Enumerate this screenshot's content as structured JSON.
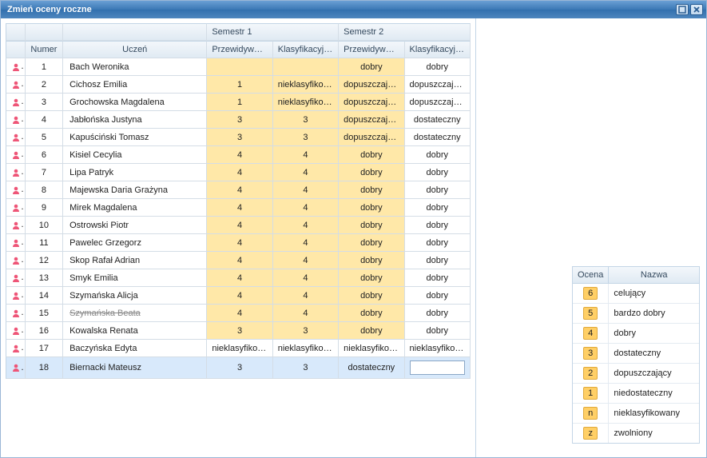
{
  "window": {
    "title": "Zmień oceny roczne"
  },
  "headers": {
    "number": "Numer",
    "student": "Uczeń",
    "sem1": "Semestr 1",
    "sem2": "Semestr 2",
    "predicted": "Przewidywana",
    "classification": "Klasyfikacyjna"
  },
  "legend": {
    "code_header": "Ocena",
    "name_header": "Nazwa",
    "items": [
      {
        "code": "6",
        "name": "celujący"
      },
      {
        "code": "5",
        "name": "bardzo dobry"
      },
      {
        "code": "4",
        "name": "dobry"
      },
      {
        "code": "3",
        "name": "dostateczny"
      },
      {
        "code": "2",
        "name": "dopuszczający"
      },
      {
        "code": "1",
        "name": "niedostateczny"
      },
      {
        "code": "n",
        "name": "nieklasyfikowany"
      },
      {
        "code": "z",
        "name": "zwolniony"
      }
    ]
  },
  "rows": [
    {
      "num": "1",
      "name": "Bach Weronika",
      "s1p": "",
      "s1k": "",
      "s2p": "dobry",
      "s2k": "dobry"
    },
    {
      "num": "2",
      "name": "Cichosz Emilia",
      "s1p": "1",
      "s1k": "nieklasyfikow...",
      "s2p": "dopuszczający",
      "s2k": "dopuszczający"
    },
    {
      "num": "3",
      "name": "Grochowska Magdalena",
      "s1p": "1",
      "s1k": "nieklasyfikow...",
      "s2p": "dopuszczający",
      "s2k": "dopuszczający"
    },
    {
      "num": "4",
      "name": "Jabłońska Justyna",
      "s1p": "3",
      "s1k": "3",
      "s2p": "dopuszczający",
      "s2k": "dostateczny"
    },
    {
      "num": "5",
      "name": "Kapuściński Tomasz",
      "s1p": "3",
      "s1k": "3",
      "s2p": "dopuszczający",
      "s2k": "dostateczny"
    },
    {
      "num": "6",
      "name": "Kisiel Cecylia",
      "s1p": "4",
      "s1k": "4",
      "s2p": "dobry",
      "s2k": "dobry"
    },
    {
      "num": "7",
      "name": "Lipa Patryk",
      "s1p": "4",
      "s1k": "4",
      "s2p": "dobry",
      "s2k": "dobry"
    },
    {
      "num": "8",
      "name": "Majewska Daria Grażyna",
      "s1p": "4",
      "s1k": "4",
      "s2p": "dobry",
      "s2k": "dobry"
    },
    {
      "num": "9",
      "name": "Mirek Magdalena",
      "s1p": "4",
      "s1k": "4",
      "s2p": "dobry",
      "s2k": "dobry"
    },
    {
      "num": "10",
      "name": "Ostrowski Piotr",
      "s1p": "4",
      "s1k": "4",
      "s2p": "dobry",
      "s2k": "dobry"
    },
    {
      "num": "11",
      "name": "Pawelec Grzegorz",
      "s1p": "4",
      "s1k": "4",
      "s2p": "dobry",
      "s2k": "dobry"
    },
    {
      "num": "12",
      "name": "Skop Rafał Adrian",
      "s1p": "4",
      "s1k": "4",
      "s2p": "dobry",
      "s2k": "dobry"
    },
    {
      "num": "13",
      "name": "Smyk Emilia",
      "s1p": "4",
      "s1k": "4",
      "s2p": "dobry",
      "s2k": "dobry"
    },
    {
      "num": "14",
      "name": "Szymańska Alicja",
      "s1p": "4",
      "s1k": "4",
      "s2p": "dobry",
      "s2k": "dobry"
    },
    {
      "num": "15",
      "name": "Szymańska Beata",
      "s1p": "4",
      "s1k": "4",
      "s2p": "dobry",
      "s2k": "dobry",
      "strike": true
    },
    {
      "num": "16",
      "name": "Kowalska Renata",
      "s1p": "3",
      "s1k": "3",
      "s2p": "dobry",
      "s2k": "dobry"
    },
    {
      "num": "17",
      "name": "Baczyńska Edyta",
      "s1p": "nieklasyfikow...",
      "s1k": "nieklasyfikow...",
      "s2p": "nieklasyfikow...",
      "s2k": "nieklasyfikow...",
      "hl": false
    },
    {
      "num": "18",
      "name": "Biernacki Mateusz",
      "s1p": "3",
      "s1k": "3",
      "s2p": "dostateczny",
      "s2k": "",
      "selected": true,
      "edit": true,
      "hl": false
    }
  ]
}
